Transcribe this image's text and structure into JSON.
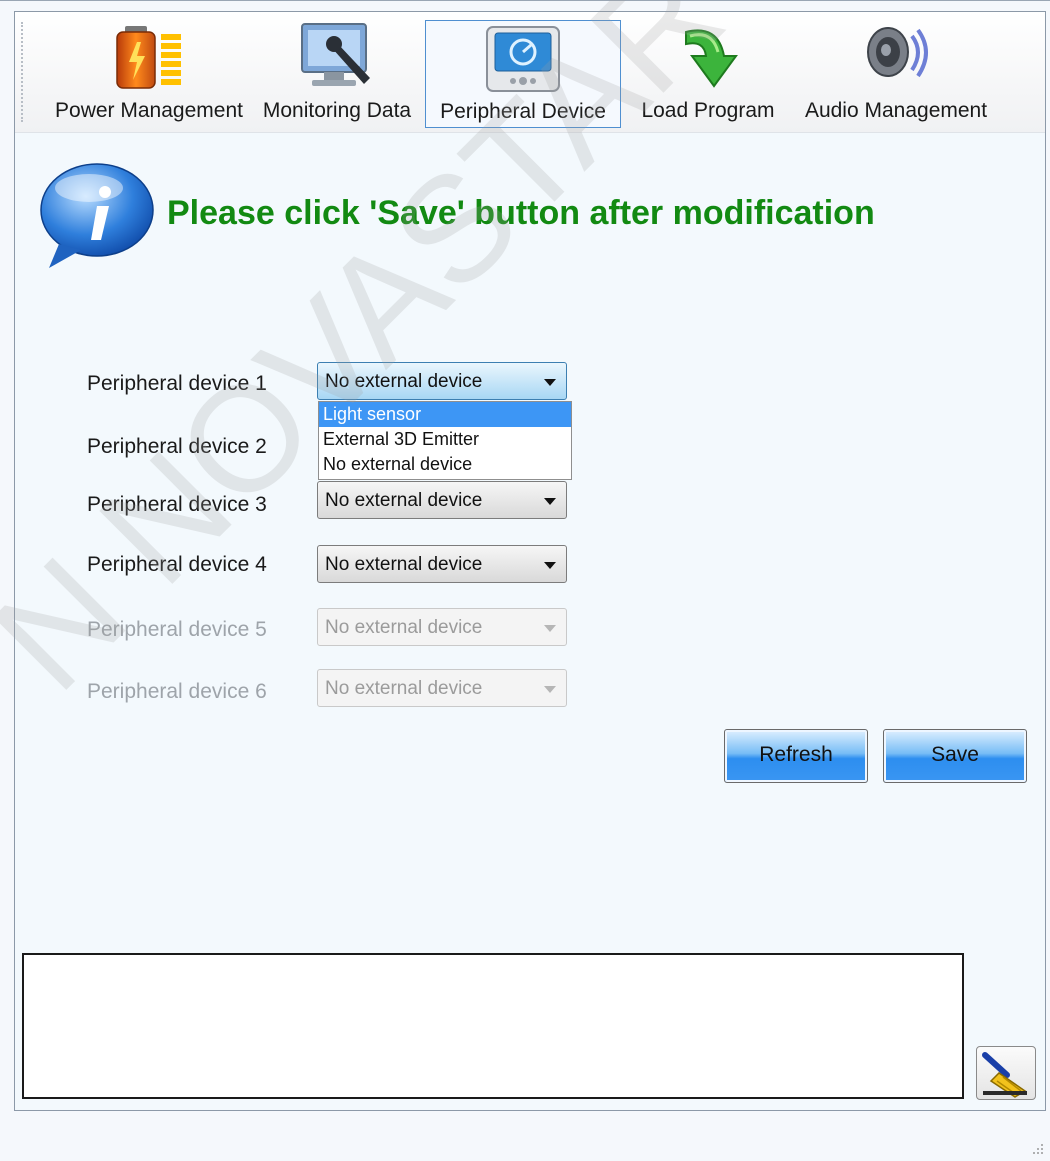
{
  "toolbar": {
    "tabs": [
      {
        "label": "Power Management",
        "icon": "battery-icon"
      },
      {
        "label": "Monitoring Data",
        "icon": "monitor-wrench-icon"
      },
      {
        "label": "Peripheral Device",
        "icon": "peripheral-device-icon",
        "active": true
      },
      {
        "label": "Load Program",
        "icon": "load-arrow-icon"
      },
      {
        "label": "Audio Management",
        "icon": "speaker-icon"
      }
    ]
  },
  "info": {
    "icon": "info-icon",
    "message": "Please click 'Save' button after modification",
    "color": "#128a12"
  },
  "devices": [
    {
      "label": "Peripheral device 1",
      "value": "No external device",
      "enabled": true,
      "open": true
    },
    {
      "label": "Peripheral device 2",
      "value": "",
      "enabled": true
    },
    {
      "label": "Peripheral device 3",
      "value": "No external device",
      "enabled": true
    },
    {
      "label": "Peripheral device 4",
      "value": "No external device",
      "enabled": true
    },
    {
      "label": "Peripheral device 5",
      "value": "No external device",
      "enabled": false
    },
    {
      "label": "Peripheral device 6",
      "value": "No external device",
      "enabled": false
    }
  ],
  "dropdown": {
    "options": [
      "Light sensor",
      "External 3D Emitter",
      "No external device"
    ],
    "highlighted_index": 0,
    "highlight_color": "#3d96f5"
  },
  "buttons": {
    "refresh": "Refresh",
    "save": "Save"
  },
  "log": {
    "clear_icon": "broom-icon"
  },
  "watermark": "N NOVASTAR TECH CO., LTD"
}
